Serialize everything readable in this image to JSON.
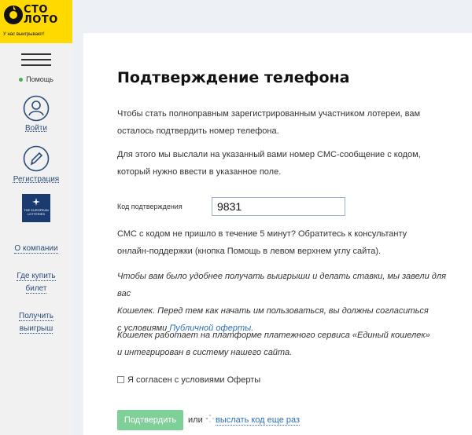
{
  "brand": {
    "name_line1": "СТО",
    "name_line2": "ЛОТО",
    "tagline": "У нас выигрывают!",
    "color": "#ffd900"
  },
  "sidebar": {
    "help": "Помощь",
    "login": "Войти",
    "register": "Регистрация",
    "euro_text": "THE EUROPEAN LOTTERIES",
    "about": "О компании",
    "where_buy_1": "Где купить",
    "where_buy_2": "билет",
    "get_win_1": "Получить",
    "get_win_2": "выигрыш"
  },
  "page": {
    "title": "Подтверждение телефона",
    "intro_1": "Чтобы стать полноправным зарегистрированным участником лотереи, вам",
    "intro_2": "осталось подтвердить номер телефона.",
    "sent_1": "Для этого мы выслали на указанный вами номер СМС-сообщение с кодом,",
    "sent_2": "который нужно ввести в указанное поле.",
    "code_label": "Код подтверждения",
    "code_value": "9831",
    "no_sms_1": "СМС с кодом не пришло в течение 5 минут? Обратитесь к консультанту",
    "no_sms_2": "онлайн-поддержки (кнопка Помощь в левом верхнем углу сайта).",
    "wallet_1": "Чтобы вам было удобнее получать выигрыши и делать ставки, мы завели для вас",
    "wallet_2": "Кошелек. Перед тем как начать им пользоваться, вы должны согласиться",
    "wallet_3_prefix": "с условиями ",
    "wallet_3_link": "Публичной оферты.",
    "platform_1": "Кошелек работает на платформе платежного сервиса «Единый кошелек»",
    "platform_2": "и интегрирован в систему нашего сайта.",
    "agree": "Я согласен с условиями Оферты",
    "submit": "Подтвердить",
    "or": "или",
    "resend": "выслать код еще раз"
  }
}
